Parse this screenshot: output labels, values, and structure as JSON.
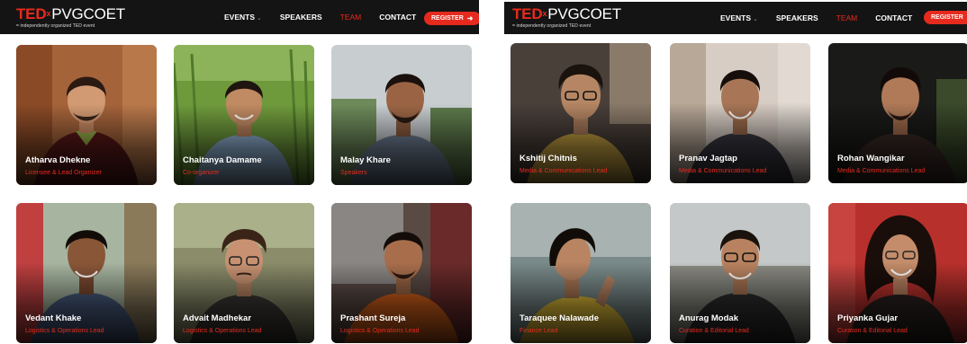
{
  "brand": {
    "ted": "TED",
    "x": "x",
    "name": "PVGCOET",
    "tagline": "= independently organized TED event",
    "accent": "#e62b1e"
  },
  "nav": {
    "items": [
      "EVENTS",
      "SPEAKERS",
      "TEAM",
      "CONTACT"
    ],
    "active": "TEAM",
    "register": "REGISTER",
    "register_icon": "arrow-right-icon",
    "dropdown_icon": "chevron-down-icon"
  },
  "left_panel": {
    "members": [
      {
        "name": "Atharva Dhekne",
        "role": "Licensee & Lead Organizer"
      },
      {
        "name": "Chaitanya Damame",
        "role": "Co-organizer"
      },
      {
        "name": "Malay Khare",
        "role": "Speakers"
      },
      {
        "name": "Vedant Khake",
        "role": "Logistics & Operations Lead"
      },
      {
        "name": "Advait Madhekar",
        "role": "Logistics & Operations Lead"
      },
      {
        "name": "Prashant Sureja",
        "role": "Logistics & Operations Lead"
      }
    ]
  },
  "right_panel": {
    "members": [
      {
        "name": "Kshitij Chitnis",
        "role": "Media & Communications Lead"
      },
      {
        "name": "Pranav Jagtap",
        "role": "Media & Communications Lead"
      },
      {
        "name": "Rohan Wangikar",
        "role": "Media & Communications Lead"
      },
      {
        "name": "Taraquee Nalawade",
        "role": "Finance Lead"
      },
      {
        "name": "Anurag Modak",
        "role": "Curation & Editorial Lead"
      },
      {
        "name": "Priyanka Gujar",
        "role": "Curation & Editorial Lead"
      }
    ]
  }
}
